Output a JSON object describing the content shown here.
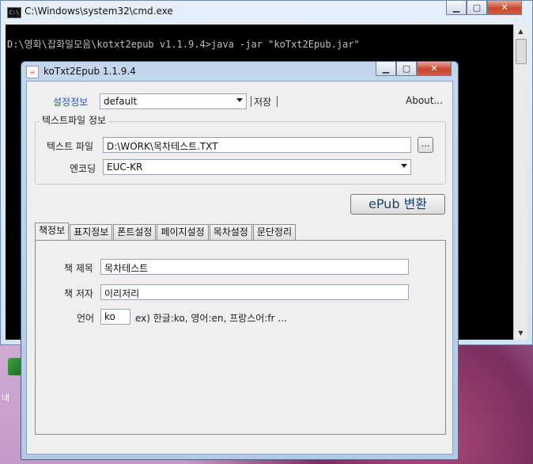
{
  "cmd": {
    "title": "C:\\Windows\\system32\\cmd.exe",
    "icon_text": "C:\\",
    "command_line": "D:\\영화\\잡화일모음\\kotxt2epub v1.1.9.4>java -jar \"koTxt2Epub.jar\"",
    "minimize_label": "▁",
    "maximize_label": "▢",
    "close_label": "✕",
    "scroll_up": "▲",
    "scroll_down": "▼"
  },
  "desktop": {
    "icon_label": "네"
  },
  "app": {
    "title": "koTxt2Epub 1.1.9.4",
    "minimize_label": "▁",
    "maximize_label": "▢",
    "close_label": "✕",
    "settings": {
      "label": "설정정보",
      "profile_value": "default",
      "save_label": "저장",
      "about_label": "About..."
    },
    "text_file_group": {
      "title": "텍스트파일 정보",
      "file_label": "텍스트 파일",
      "file_value": "D:\\WORK\\목차테스트.TXT",
      "browse_label": "...",
      "encoding_label": "엔코딩",
      "encoding_value": "EUC-KR"
    },
    "convert_button": "ePub 변환",
    "tabs": [
      "책정보",
      "표지정보",
      "폰트설정",
      "페이지설정",
      "목차설정",
      "문단정리"
    ],
    "active_tab": "책정보",
    "book": {
      "title_label": "책 제목",
      "title_value": "목차테스트",
      "author_label": "책 저자",
      "author_value": "이리저리",
      "language_label": "언어",
      "language_value": "ko",
      "language_hint": "ex) 한글:ko, 영어:en, 프랑스어:fr ..."
    }
  }
}
